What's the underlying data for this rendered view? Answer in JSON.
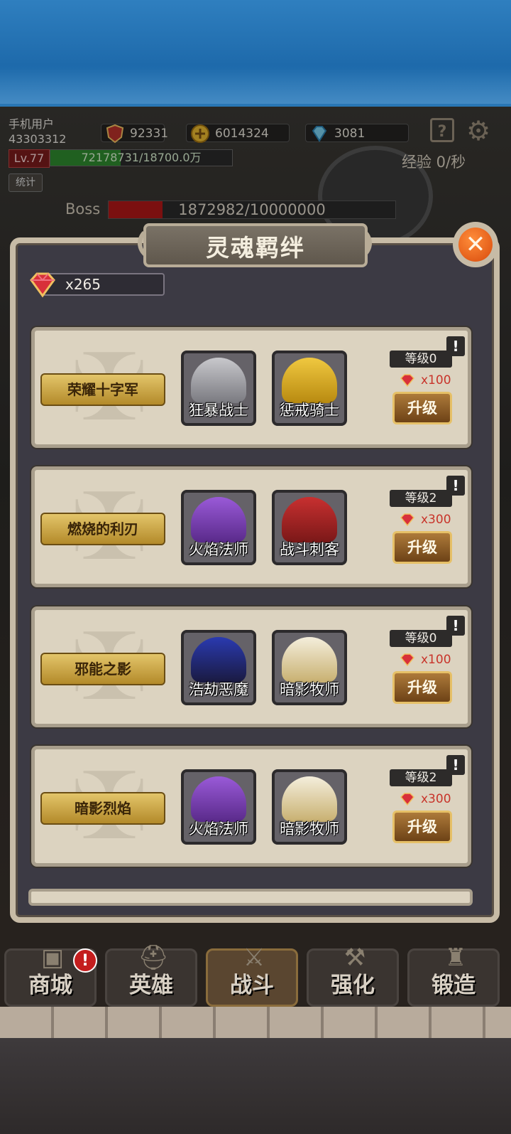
{
  "hud": {
    "username": "手机用户",
    "user_id": "43303312",
    "power": "92331",
    "gold": "6014324",
    "diamonds": "3081",
    "level": "Lv.77",
    "exp_text": "72178731/18700.0万",
    "exp_fraction": 0.386,
    "stats_button": "统计",
    "exp_rate": "经验 0/秒",
    "boss_label": "Boss",
    "boss_hp_text": "1872982/10000000",
    "boss_hp_fraction": 0.187
  },
  "dialog": {
    "title": "灵魂羁绊",
    "close_symbol": "✕",
    "soul_gems": "x265"
  },
  "bonds": [
    {
      "name": "荣耀十字军",
      "level": "等级0",
      "cost": "x100",
      "upgrade": "升级",
      "info": "!",
      "heroes": [
        "狂暴战士",
        "惩戒骑士"
      ]
    },
    {
      "name": "燃烧的利刃",
      "level": "等级2",
      "cost": "x300",
      "upgrade": "升级",
      "info": "!",
      "heroes": [
        "火焰法师",
        "战斗刺客"
      ]
    },
    {
      "name": "邪能之影",
      "level": "等级0",
      "cost": "x100",
      "upgrade": "升级",
      "info": "!",
      "heroes": [
        "浩劫恶魔",
        "暗影牧师"
      ]
    },
    {
      "name": "暗影烈焰",
      "level": "等级2",
      "cost": "x300",
      "upgrade": "升级",
      "info": "!",
      "heroes": [
        "火焰法师",
        "暗影牧师"
      ]
    }
  ],
  "nav": {
    "shop": "商城",
    "heroes": "英雄",
    "battle": "战斗",
    "enhance": "强化",
    "forge": "锻造",
    "shop_badge": "!"
  },
  "colors": {
    "accent_gold": "#e6c067",
    "close_orange": "#e86a1c",
    "gem_red": "#c8342a"
  }
}
